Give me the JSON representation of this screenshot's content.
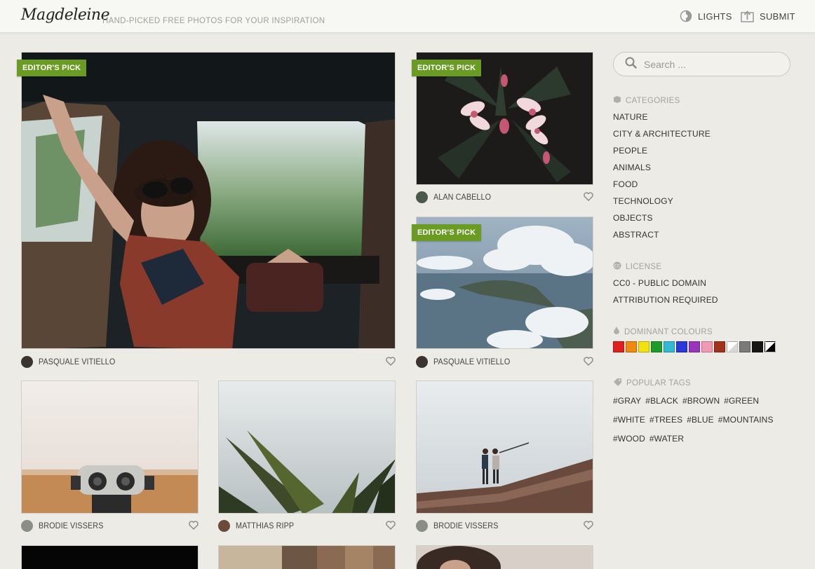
{
  "header": {
    "logo": "Magdeleine",
    "tagline": "HAND-PICKED FREE PHOTOS FOR YOUR INSPIRATION",
    "lights_label": "LIGHTS",
    "submit_label": "SUBMIT"
  },
  "photos": [
    {
      "badge": "EDITOR'S PICK",
      "author": "PASQUALE VITIELLO"
    },
    {
      "badge": "EDITOR'S PICK",
      "author": "ALAN CABELLO"
    },
    {
      "badge": "EDITOR'S PICK",
      "author": "PASQUALE VITIELLO"
    },
    {
      "author": "BRODIE VISSERS"
    },
    {
      "author": "MATTHIAS RIPP"
    },
    {
      "author": "BRODIE VISSERS"
    }
  ],
  "sidebar": {
    "search_placeholder": "Search ...",
    "categories_title": "CATEGORIES",
    "categories": [
      "NATURE",
      "CITY & ARCHITECTURE",
      "PEOPLE",
      "ANIMALS",
      "FOOD",
      "TECHNOLOGY",
      "OBJECTS",
      "ABSTRACT"
    ],
    "license_title": "LICENSE",
    "licenses": [
      "CC0 - PUBLIC DOMAIN",
      "ATTRIBUTION REQUIRED"
    ],
    "colours_title": "DOMINANT COLOURS",
    "colours": [
      "#e0201c",
      "#f08a0e",
      "#f2e20e",
      "#1e9c2a",
      "#32b9d4",
      "#2a3ad8",
      "#9a34b8",
      "#f29ab4",
      "#a3321c",
      "#ffffff",
      "#7a7a7a",
      "#161616",
      "#000000"
    ],
    "tags_title": "POPULAR TAGS",
    "tag_rows": [
      [
        "#GRAY",
        "#BLACK",
        "#BROWN",
        "#GREEN"
      ],
      [
        "#WHITE",
        "#TREES",
        "#BLUE",
        "#MOUNTAINS"
      ],
      [
        "#WOOD",
        "#WATER"
      ]
    ]
  }
}
